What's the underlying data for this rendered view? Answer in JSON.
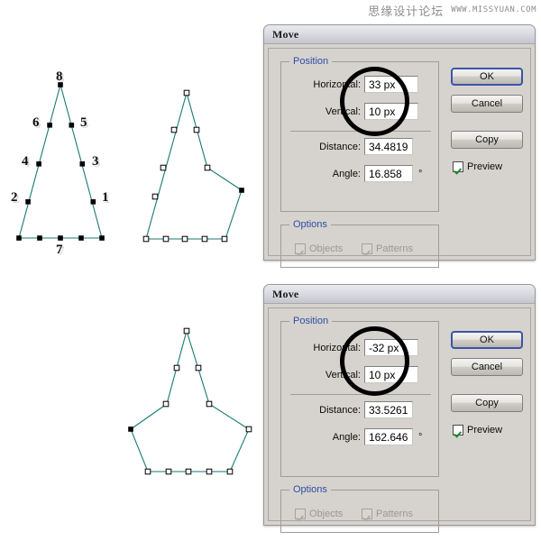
{
  "watermark": {
    "cn_text": "思缘设计论坛",
    "url_text": "WWW.MISSYUAN.COM"
  },
  "artwork": {
    "triangle_labels": [
      "1",
      "2",
      "3",
      "4",
      "5",
      "6",
      "7",
      "8"
    ],
    "stroke_color": "#1a7a70",
    "anchor_fill_selected": "#000000",
    "anchor_fill_unselected": "#ffffff"
  },
  "dialogs": [
    {
      "title": "Move",
      "position_group": {
        "legend": "Position",
        "horizontal_label": "Horizontal:",
        "horizontal_value": "33 px",
        "vertical_label": "Vertical:",
        "vertical_value": "10 px",
        "distance_label": "Distance:",
        "distance_value": "34.4819",
        "angle_label": "Angle:",
        "angle_value": "16.858",
        "angle_unit": "°"
      },
      "options_group": {
        "legend": "Options",
        "objects_label": "Objects",
        "objects_checked": true,
        "objects_enabled": false,
        "patterns_label": "Patterns",
        "patterns_checked": true,
        "patterns_enabled": false
      },
      "buttons": {
        "ok": "OK",
        "cancel": "Cancel",
        "copy": "Copy"
      },
      "preview": {
        "label": "Preview",
        "checked": true
      }
    },
    {
      "title": "Move",
      "position_group": {
        "legend": "Position",
        "horizontal_label": "Horizontal:",
        "horizontal_value": "-32 px",
        "vertical_label": "Vertical:",
        "vertical_value": "10 px",
        "distance_label": "Distance:",
        "distance_value": "33.5261",
        "angle_label": "Angle:",
        "angle_value": "162.646",
        "angle_unit": "°"
      },
      "options_group": {
        "legend": "Options",
        "objects_label": "Objects",
        "objects_checked": true,
        "objects_enabled": false,
        "patterns_label": "Patterns",
        "patterns_checked": true,
        "patterns_enabled": false
      },
      "buttons": {
        "ok": "OK",
        "cancel": "Cancel",
        "copy": "Copy"
      },
      "preview": {
        "label": "Preview",
        "checked": true
      }
    }
  ]
}
